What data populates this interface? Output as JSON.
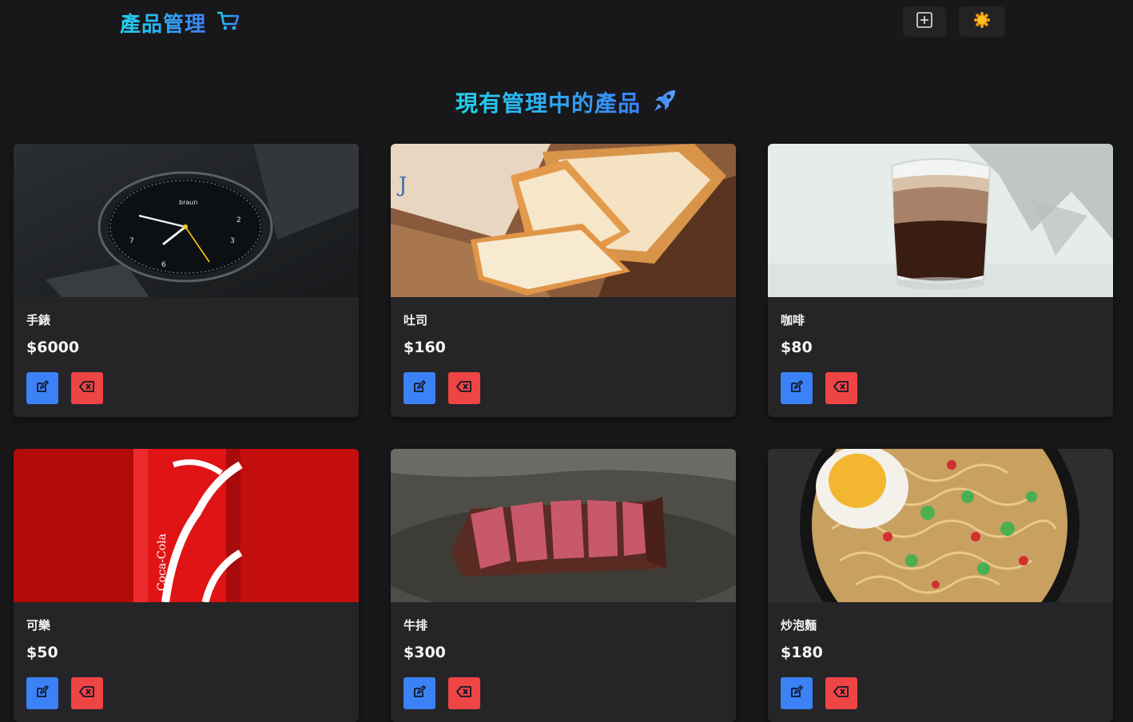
{
  "header": {
    "title": "產品管理",
    "brand_icon": "shopping-cart-icon",
    "add_icon": "plus-square-icon",
    "theme_icon": "sun-icon"
  },
  "main": {
    "heading": "現有管理中的產品",
    "heading_icon": "rocket-icon"
  },
  "products": [
    {
      "name": "手錶",
      "price": "$6000",
      "image": "watch-photo"
    },
    {
      "name": "吐司",
      "price": "$160",
      "image": "toast-photo"
    },
    {
      "name": "咖啡",
      "price": "$80",
      "image": "coffee-photo"
    },
    {
      "name": "可樂",
      "price": "$50",
      "image": "cola-photo"
    },
    {
      "name": "牛排",
      "price": "$300",
      "image": "steak-photo"
    },
    {
      "name": "炒泡麵",
      "price": "$180",
      "image": "noodles-photo"
    }
  ],
  "actions": {
    "edit_icon": "edit-icon",
    "delete_icon": "backspace-icon"
  },
  "colors": {
    "background": "#18181b",
    "card": "#252528",
    "accent_start": "#22d3ee",
    "accent_end": "#3b82f6",
    "edit": "#3b82f6",
    "delete": "#ef4444"
  }
}
